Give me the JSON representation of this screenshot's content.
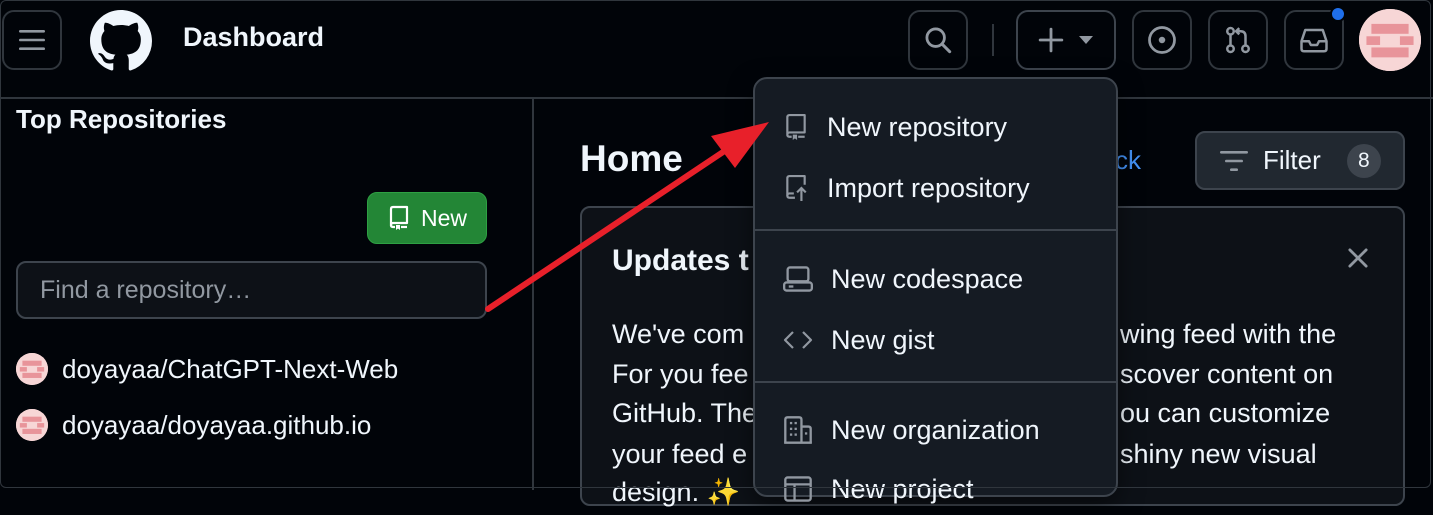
{
  "header": {
    "context_title": "Dashboard",
    "notification_dot_color": "#1f6feb",
    "icons": [
      "menu-icon",
      "github-logo-icon",
      "search-icon",
      "plus-icon",
      "chevron-down-icon",
      "issue-icon",
      "pull-request-icon",
      "inbox-icon"
    ]
  },
  "sidebar": {
    "title": "Top Repositories",
    "new_button_label": "New",
    "search_placeholder": "Find a repository…",
    "repos": [
      {
        "name": "doyayaa/ChatGPT-Next-Web"
      },
      {
        "name": "doyayaa/doyayaa.github.io"
      }
    ]
  },
  "main": {
    "title": "Home",
    "feedback_fragment": "ck",
    "filter_label": "Filter",
    "filter_count": "8",
    "card": {
      "title_visible": "Updates t",
      "lines_left": [
        "We've com",
        "For you fee",
        "GitHub. The",
        "your feed e",
        "design. ✨"
      ],
      "lines_right": [
        "wing feed with the",
        "scover content on",
        "ou can customize",
        "shiny new visual",
        ""
      ]
    }
  },
  "create_menu": {
    "items": [
      {
        "label": "New repository",
        "icon": "repo-icon"
      },
      {
        "label": "Import repository",
        "icon": "repo-push-icon"
      },
      {
        "label": "New codespace",
        "icon": "codespaces-icon"
      },
      {
        "label": "New gist",
        "icon": "code-icon"
      },
      {
        "label": "New organization",
        "icon": "organization-icon"
      },
      {
        "label": "New project",
        "icon": "table-icon"
      }
    ]
  },
  "annotation": {
    "arrow_color": "#e8202a"
  },
  "colors": {
    "accent_green": "#238636",
    "link_blue": "#4493f8",
    "background": "#010409"
  }
}
